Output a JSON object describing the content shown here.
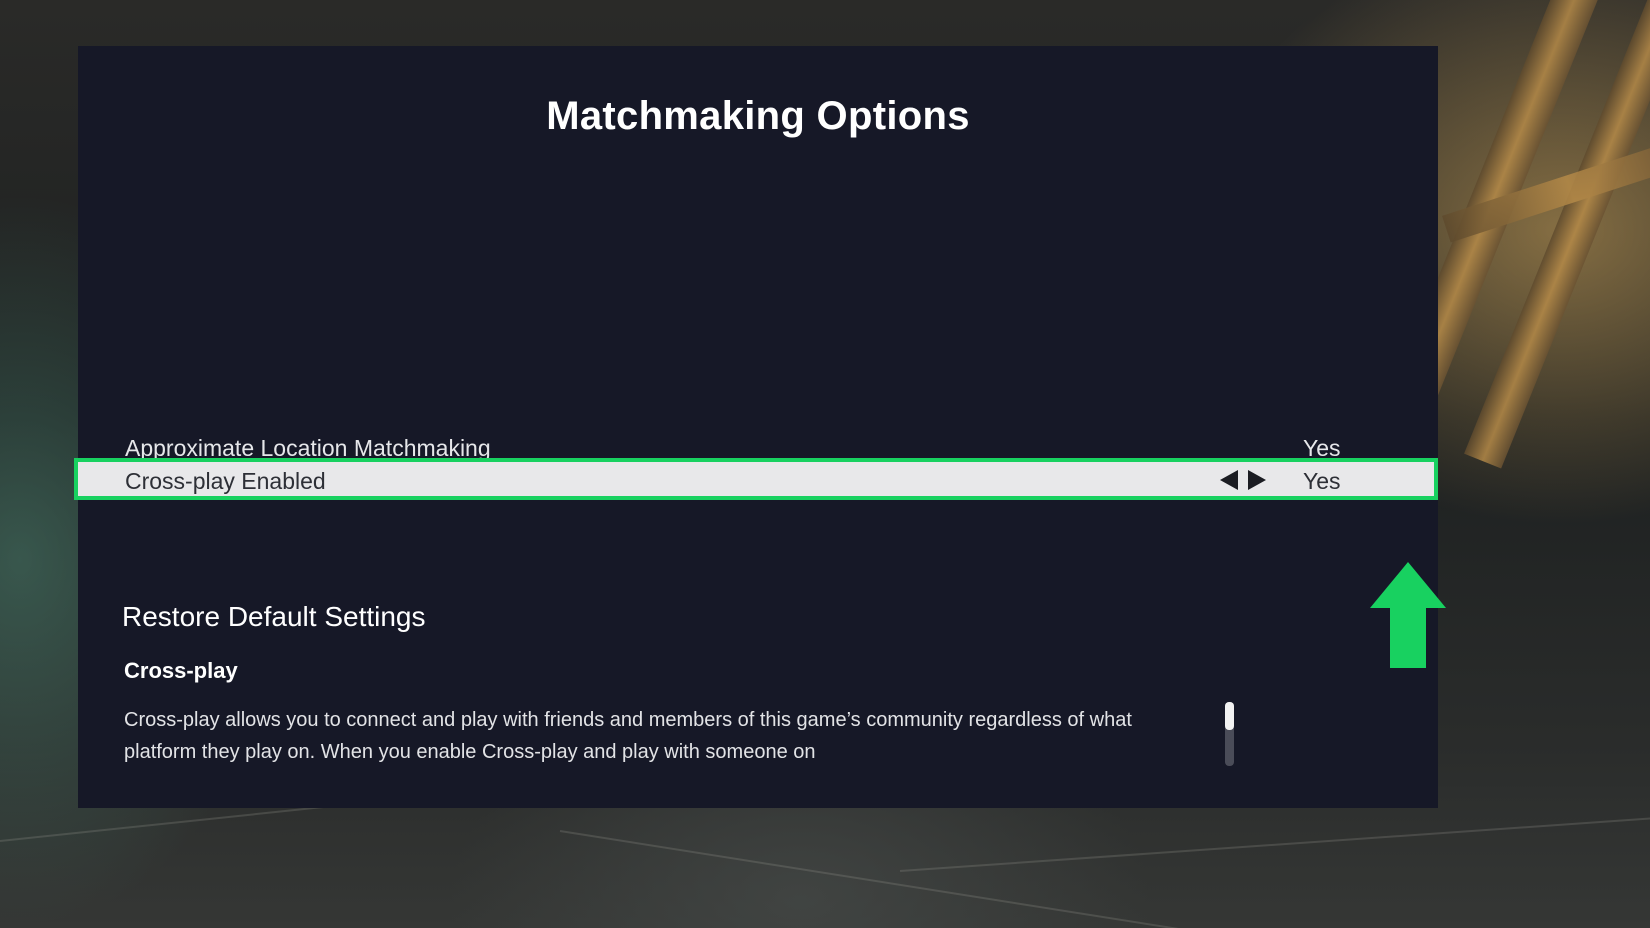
{
  "panel": {
    "title": "Matchmaking Options"
  },
  "options": [
    {
      "label": "Approximate Location Matchmaking",
      "value": "Yes"
    },
    {
      "label": "Cross-play Enabled",
      "value": "Yes",
      "selected": true
    }
  ],
  "restore_defaults_label": "Restore Default Settings",
  "description": {
    "title": "Cross-play",
    "body": "Cross-play allows you to connect and play with friends and members of this game’s community regardless of what platform they play on. When you enable Cross-play and play with someone on"
  },
  "colors": {
    "highlight_border": "#18d160",
    "annotation_arrow": "#18d160",
    "panel_background": "#161827"
  },
  "icons": {
    "value_left": "arrow-left-icon",
    "value_right": "arrow-right-icon",
    "annotation": "up-arrow-icon"
  }
}
